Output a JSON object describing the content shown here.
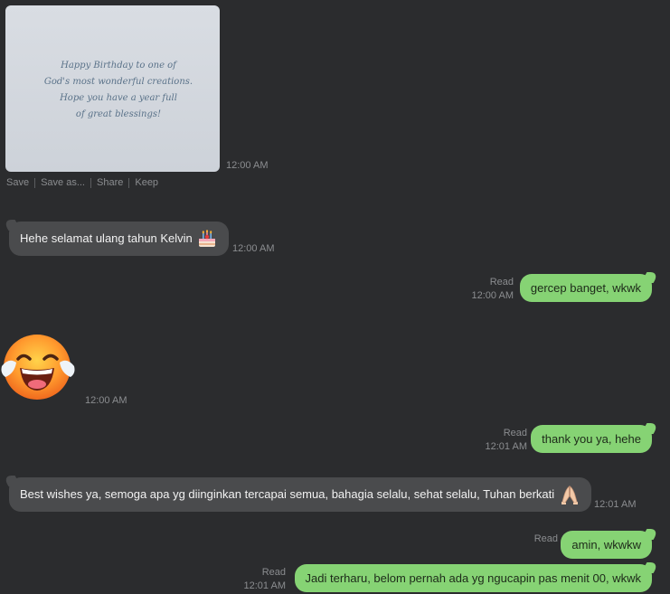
{
  "image_message": {
    "card_lines": [
      "Happy Birthday to one of",
      "God's most wonderful creations.",
      "Hope you have a year full",
      "of great blessings!"
    ],
    "time": "12:00 AM",
    "actions": [
      "Save",
      "Save as...",
      "Share",
      "Keep"
    ]
  },
  "messages": [
    {
      "text": "Hehe selamat ulang tahun Kelvin",
      "emoji": "birthday-cake-icon",
      "time": "12:00 AM"
    },
    {
      "text": "gercep banget, wkwk",
      "status": "Read",
      "time": "12:00 AM"
    },
    {
      "sticker": "tears-of-joy-icon",
      "time": "12:00 AM"
    },
    {
      "text": "thank you ya, hehe",
      "status": "Read",
      "time": "12:01 AM"
    },
    {
      "text": "Best wishes ya, semoga apa yg diinginkan tercapai semua, bahagia selalu, sehat selalu, Tuhan berkati",
      "emoji": "praying-hands-icon",
      "time": "12:01 AM"
    },
    {
      "text": "amin, wkwkw",
      "status": "Read",
      "time": ""
    },
    {
      "text": "Jadi terharu, belom pernah ada yg ngucapin pas menit 00, wkwk",
      "status": "Read",
      "time": "12:01 AM"
    }
  ],
  "colors": {
    "background": "#2b2c2e",
    "incoming": "#4a4b4d",
    "outgoing": "#86d374"
  }
}
